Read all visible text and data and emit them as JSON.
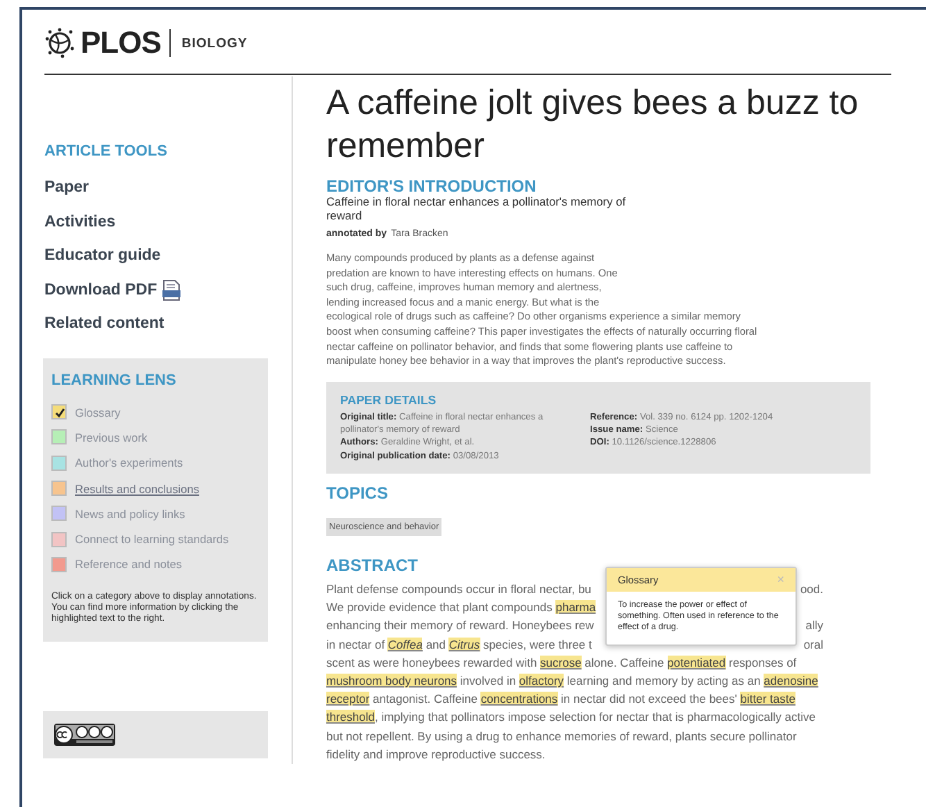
{
  "header": {
    "logo": "PLOS",
    "journal": "BIOLOGY"
  },
  "article_tools": {
    "heading": "ARTICLE TOOLS",
    "items": [
      {
        "label": "Paper",
        "kind": "link"
      },
      {
        "label": "Activities",
        "kind": "link"
      },
      {
        "label": "Educator guide",
        "kind": "link"
      },
      {
        "label": "Download PDF",
        "kind": "pdf"
      },
      {
        "label": "Related content",
        "kind": "link"
      }
    ]
  },
  "learning_lens": {
    "heading": "LEARNING LENS",
    "items": [
      {
        "label": "Glossary",
        "color": "#f5dd7a",
        "checked": true,
        "hovered": false
      },
      {
        "label": "Previous work",
        "color": "#b6efb6",
        "checked": false,
        "hovered": false
      },
      {
        "label": "Author's experiments",
        "color": "#a8e3e3",
        "checked": false,
        "hovered": false
      },
      {
        "label": "Results and conclusions",
        "color": "#f7c48e",
        "checked": false,
        "hovered": true
      },
      {
        "label": "News and policy links",
        "color": "#c2c2f5",
        "checked": false,
        "hovered": false
      },
      {
        "label": "Connect to learning standards",
        "color": "#f2c4c4",
        "checked": false,
        "hovered": false
      },
      {
        "label": "Reference and notes",
        "color": "#f29a8e",
        "checked": false,
        "hovered": false
      }
    ],
    "note": "Click on a category above to display annotations. You can find more information by clicking the highlighted text to the right."
  },
  "license": {
    "kind": "cc-by"
  },
  "article": {
    "title": "A caffeine jolt gives bees a buzz to remember",
    "editors_intro": {
      "heading": "EDITOR'S INTRODUCTION",
      "subtitle": "Caffeine in floral nectar enhances a pollinator's memory of reward",
      "annotated_label": "annotated by",
      "annotator": "Tara Bracken",
      "lines": [
        "Many compounds produced by plants as a defense against",
        "predation are known to have interesting effects on humans. One",
        "such drug, caffeine, improves human memory and alertness,",
        "lending increased focus and a manic energy. But what is the",
        "ecological role of drugs such as caffeine? Do other organisms experience a similar memory",
        "boost when consuming caffeine? This paper investigates the effects of naturally occurring floral",
        "nectar caffeine on pollinator behavior, and finds that some flowering plants use caffeine to",
        "manipulate honey bee behavior in a way that improves the plant's reproductive success."
      ]
    },
    "paper_details": {
      "heading": "PAPER DETAILS",
      "columns": [
        [
          {
            "label": "Original title:",
            "value": "Caffeine in floral nectar enhances a pollinator's memory of reward"
          },
          {
            "label": "Authors:",
            "value": "Geraldine Wright, et al."
          },
          {
            "label": "Original publication date:",
            "value": "03/08/2013"
          }
        ],
        [
          {
            "label": "Reference:",
            "value": "Vol. 339 no. 6124 pp. 1202-1204"
          },
          {
            "label": "Issue name:",
            "value": "Science"
          },
          {
            "label": "DOI:",
            "value": "10.1126/science.1228806"
          }
        ]
      ]
    },
    "topics": {
      "heading": "TOPICS",
      "tags": [
        "Neuroscience and behavior"
      ]
    },
    "abstract": {
      "heading": "ABSTRACT",
      "lines": [
        {
          "left": [
            {
              "text": "Plant defense compounds occur in floral nectar, bu",
              "highlighted": false,
              "italic": false
            }
          ],
          "right": [
            {
              "text": "ood.",
              "highlighted": false,
              "italic": false
            }
          ]
        },
        {
          "left": [
            {
              "text": "We provide evidence that plant compounds ",
              "highlighted": false,
              "italic": false
            },
            {
              "text": "pharma",
              "highlighted": true,
              "italic": false
            }
          ]
        },
        {
          "left": [
            {
              "text": "enhancing their memory of reward. Honeybees rew",
              "highlighted": false,
              "italic": false
            }
          ],
          "right": [
            {
              "text": "ally",
              "highlighted": false,
              "italic": false
            }
          ]
        },
        {
          "left": [
            {
              "text": "in nectar of ",
              "highlighted": false,
              "italic": false
            },
            {
              "text": "Coffea",
              "highlighted": true,
              "italic": true
            },
            {
              "text": " and ",
              "highlighted": false,
              "italic": false
            },
            {
              "text": "Citrus",
              "highlighted": true,
              "italic": true
            },
            {
              "text": " species, were three t",
              "highlighted": false,
              "italic": false
            }
          ],
          "right": [
            {
              "text": "oral",
              "highlighted": false,
              "italic": false
            }
          ]
        },
        {
          "left": [
            {
              "text": "scent as were honeybees rewarded with ",
              "highlighted": false,
              "italic": false
            },
            {
              "text": "sucrose",
              "highlighted": true,
              "italic": false
            },
            {
              "text": " alone. Caffeine ",
              "highlighted": false,
              "italic": false
            },
            {
              "text": "potentiated",
              "highlighted": true,
              "italic": false
            },
            {
              "text": " responses of",
              "highlighted": false,
              "italic": false
            }
          ]
        },
        {
          "left": [
            {
              "text": "mushroom body neurons",
              "highlighted": true,
              "italic": false
            },
            {
              "text": " involved in ",
              "highlighted": false,
              "italic": false
            },
            {
              "text": "olfactory",
              "highlighted": true,
              "italic": false
            },
            {
              "text": " learning and memory by acting as an ",
              "highlighted": false,
              "italic": false
            },
            {
              "text": "adenosine",
              "highlighted": true,
              "italic": false
            }
          ]
        },
        {
          "left": [
            {
              "text": "receptor",
              "highlighted": true,
              "italic": false
            },
            {
              "text": " antagonist. Caffeine ",
              "highlighted": false,
              "italic": false
            },
            {
              "text": "concentrations",
              "highlighted": true,
              "italic": false
            },
            {
              "text": " in nectar did not exceed the bees' ",
              "highlighted": false,
              "italic": false
            },
            {
              "text": "bitter taste",
              "highlighted": true,
              "italic": false
            }
          ]
        },
        {
          "left": [
            {
              "text": "threshold",
              "highlighted": true,
              "italic": false
            },
            {
              "text": ", implying that pollinators impose selection for nectar that is pharmacologically active",
              "highlighted": false,
              "italic": false
            }
          ]
        },
        {
          "left": [
            {
              "text": "but not repellent. By using a drug to enhance memories of reward, plants secure pollinator",
              "highlighted": false,
              "italic": false
            }
          ]
        },
        {
          "left": [
            {
              "text": "fidelity and improve reproductive success.",
              "highlighted": false,
              "italic": false
            }
          ]
        }
      ]
    },
    "glossary_popup": {
      "title": "Glossary",
      "close": "×",
      "text": "To increase the power or effect of something. Often used in reference to the effect of a drug."
    }
  }
}
